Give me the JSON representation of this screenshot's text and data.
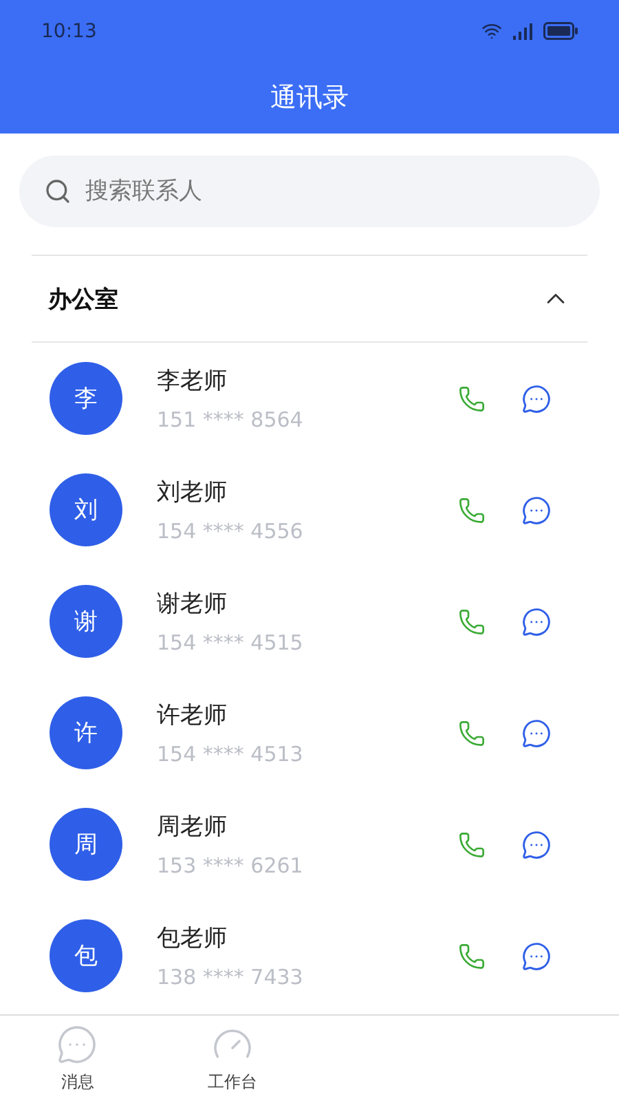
{
  "status_bar": {
    "time": "10:13"
  },
  "header": {
    "title": "通讯录"
  },
  "search": {
    "placeholder": "搜索联系人"
  },
  "group": {
    "title": "办公室",
    "expanded": true,
    "contacts": [
      {
        "initial": "李",
        "name": "李老师",
        "phone": "151 **** 8564"
      },
      {
        "initial": "刘",
        "name": "刘老师",
        "phone": "154 **** 4556"
      },
      {
        "initial": "谢",
        "name": "谢老师",
        "phone": "154 **** 4515"
      },
      {
        "initial": "许",
        "name": "许老师",
        "phone": "154 **** 4513"
      },
      {
        "initial": "周",
        "name": "周老师",
        "phone": "153 **** 6261"
      },
      {
        "initial": "包",
        "name": "包老师",
        "phone": "138 **** 7433"
      }
    ]
  },
  "tab_bar": [
    {
      "kind": "message",
      "label": "消息"
    },
    {
      "kind": "dashboard",
      "label": "工作台"
    }
  ]
}
